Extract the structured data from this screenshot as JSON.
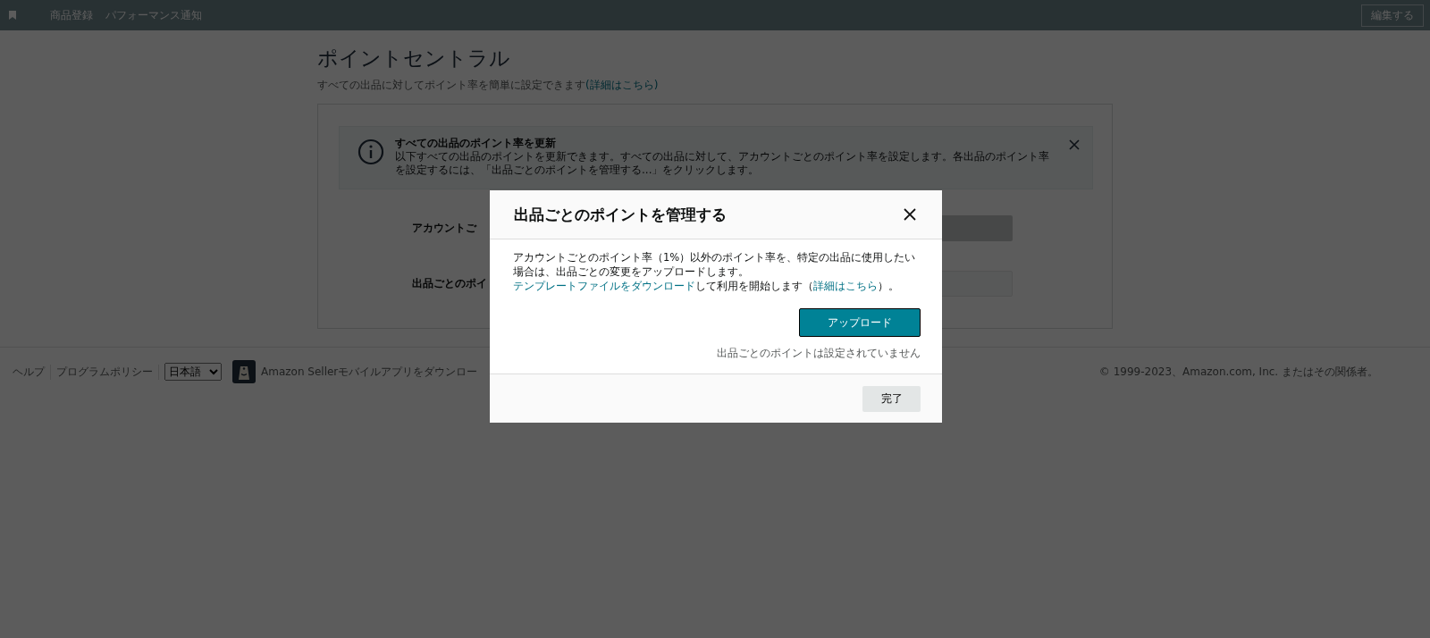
{
  "top_nav": {
    "items": [
      "商品登録",
      "パフォーマンス通知"
    ],
    "edit_button": "編集する"
  },
  "page": {
    "title": "ポイントセントラル",
    "subtitle": "すべての出品に対してポイント率を簡単に設定できます",
    "subtitle_link": "(詳細はこちら)"
  },
  "info_alert": {
    "title": "すべての出品のポイント率を更新",
    "body": "以下すべての出品のポイントを更新できます。すべての出品に対して、アカウントごとのポイント率を設定します。各出品のポイント率を設定するには、「出品ごとのポイントを管理する...」をクリックします。"
  },
  "form_rows": [
    {
      "label": "アカウントご"
    },
    {
      "label": "出品ごとのポイ"
    }
  ],
  "footer": {
    "links": [
      "ヘルプ",
      "プログラムポリシー"
    ],
    "language": "日本語",
    "app_download": "Amazon Sellerモバイルアプリをダウンロー",
    "copyright": "© 1999-2023、Amazon.com, Inc. またはその関係者。"
  },
  "modal": {
    "title": "出品ごとのポイントを管理する",
    "text_1": "アカウントごとのポイント率（1%）以外のポイント率を、特定の出品に使用したい場合は、出品ごとの変更をアップロードします。",
    "link_1": "テンプレートファイルをダウンロード",
    "text_2": "して利用を開始します（",
    "link_2": "詳細はこちら",
    "text_3": "）。",
    "upload_button": "アップロード",
    "status": "出品ごとのポイントは設定されていません",
    "done_button": "完了"
  }
}
